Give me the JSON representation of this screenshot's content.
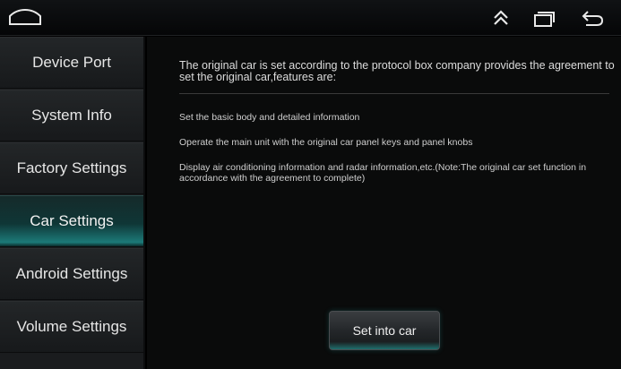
{
  "topbar": {
    "icons": [
      "home-icon",
      "chevrons-up-icon",
      "recent-apps-icon",
      "back-arrow-icon"
    ]
  },
  "sidebar": {
    "items": [
      {
        "label": "Device Port",
        "active": false
      },
      {
        "label": "System Info",
        "active": false
      },
      {
        "label": "Factory Settings",
        "active": false
      },
      {
        "label": "Car Settings",
        "active": true
      },
      {
        "label": "Android Settings",
        "active": false
      },
      {
        "label": "Volume Settings",
        "active": false
      }
    ]
  },
  "main": {
    "intro": "The original car is set according to the protocol box company provides the agreement to set the original car,features are:",
    "features": [
      "Set the basic body and detailed information",
      "Operate the main unit with the original car panel keys and panel knobs",
      "Display air conditioning information and radar information,etc.(Note:The original car set function in accordance with the agreement to complete)"
    ],
    "button_label": "Set into car"
  },
  "colors": {
    "accent": "#1c7a78",
    "background": "#0a0b0b",
    "sidebar": "#1a1c1e"
  }
}
